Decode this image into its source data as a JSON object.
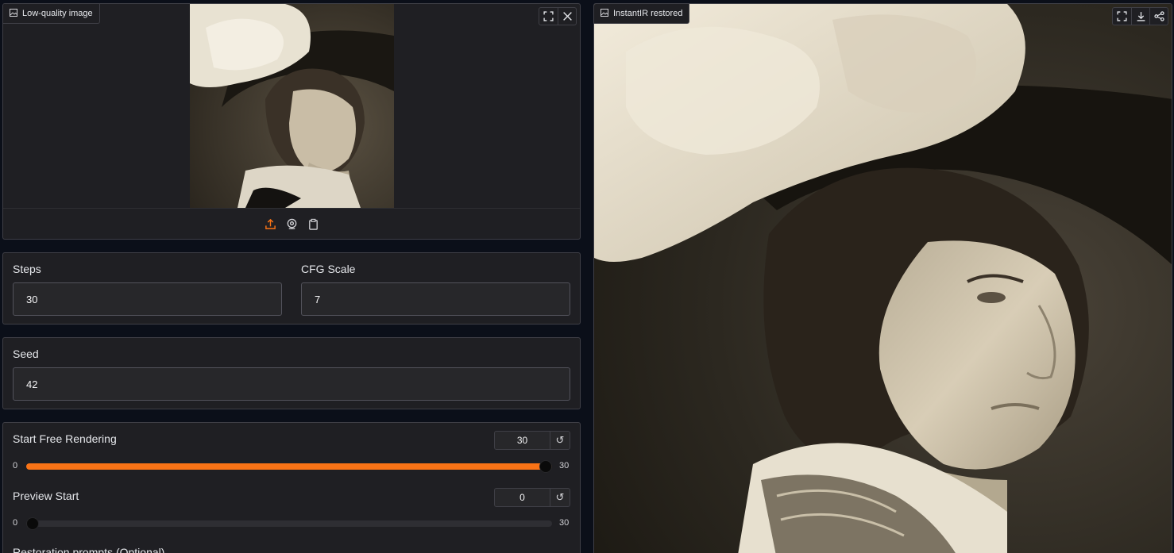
{
  "input_panel": {
    "label": "Low-quality image",
    "icons": [
      "fullscreen-icon",
      "close-icon"
    ],
    "source_icons": [
      "upload-icon",
      "webcam-icon",
      "clipboard-icon"
    ]
  },
  "output_panel": {
    "label": "InstantIR restored",
    "icons": [
      "fullscreen-icon",
      "download-icon",
      "share-icon"
    ]
  },
  "steps": {
    "label": "Steps",
    "value": "30"
  },
  "cfg": {
    "label": "CFG Scale",
    "value": "7"
  },
  "seed": {
    "label": "Seed",
    "value": "42"
  },
  "start_free": {
    "label": "Start Free Rendering",
    "value": "30",
    "min": "0",
    "max": "30",
    "fraction": 1.0
  },
  "preview_start": {
    "label": "Preview Start",
    "value": "0",
    "min": "0",
    "max": "30",
    "fraction": 0.0
  },
  "restoration": {
    "label": "Restoration prompts (Optional)"
  },
  "colors": {
    "accent": "#f97316",
    "panel": "#1f1f23",
    "border": "#3f3f46"
  }
}
